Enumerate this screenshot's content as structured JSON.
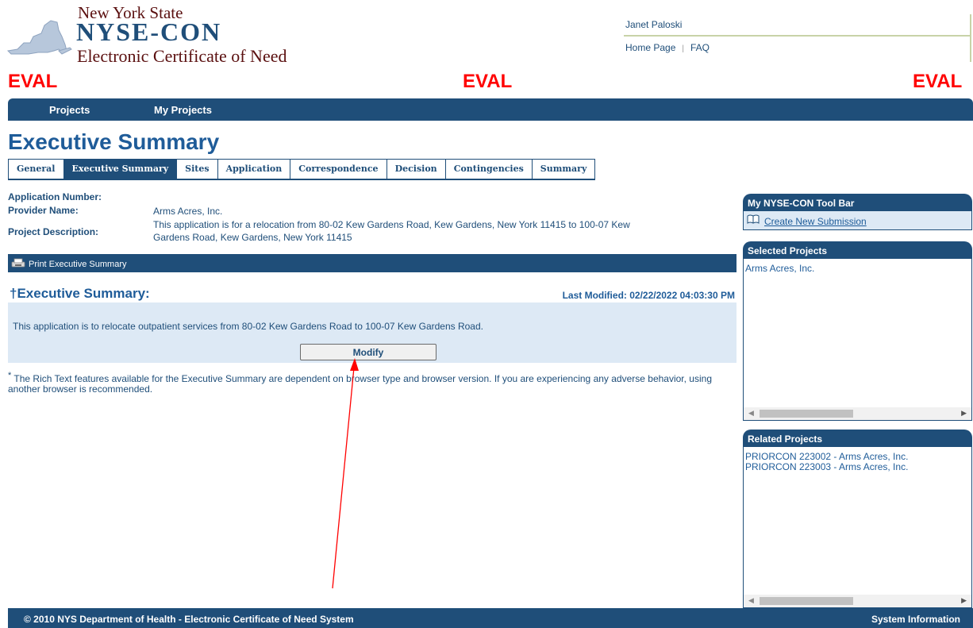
{
  "header": {
    "logo_line1": "New York State",
    "logo_line2": "NYSE-CON",
    "logo_line3": "Electronic Certificate of Need",
    "user_name": "Janet Paloski",
    "links": [
      "Home Page",
      "FAQ"
    ]
  },
  "eval_watermark": "EVAL",
  "nav": {
    "items": [
      "Projects",
      "My Projects"
    ]
  },
  "page_title": "Executive Summary",
  "tabs": [
    {
      "label": "General",
      "active": false
    },
    {
      "label": "Executive Summary",
      "active": true
    },
    {
      "label": "Sites",
      "active": false
    },
    {
      "label": "Application",
      "active": false
    },
    {
      "label": "Correspondence",
      "active": false
    },
    {
      "label": "Decision",
      "active": false
    },
    {
      "label": "Contingencies",
      "active": false
    },
    {
      "label": "Summary",
      "active": false
    }
  ],
  "info": {
    "app_number_label": "Application Number:",
    "app_number_value": "",
    "provider_label": "Provider Name:",
    "provider_value": "Arms Acres, Inc.",
    "description_label": "Project Description:",
    "description_line1": "This application is for a relocation from 80-02 Kew Gardens Road, Kew Gardens, New York 11415 to 100-07 Kew",
    "description_line2": "Gardens Road, Kew Gardens, New York 11415"
  },
  "print_bar": {
    "label": "Print Executive Summary"
  },
  "summary": {
    "heading": "†Executive Summary:",
    "last_modified": "Last Modified: 02/22/2022 04:03:30 PM",
    "text": "This application is to relocate outpatient services from 80-02 Kew Gardens Road to 100-07 Kew Gardens Road.",
    "modify_label": "Modify",
    "note_mark": "*",
    "note": " The Rich Text features available for the Executive Summary are dependent on browser type and browser version. If you are experiencing any adverse behavior, using another browser is recommended."
  },
  "sidebar": {
    "toolbar_title": "My NYSE-CON Tool Bar",
    "create_label": "Create New Submission",
    "selected_title": "Selected Projects",
    "selected_items": [
      "Arms Acres, Inc."
    ],
    "related_title": "Related Projects",
    "related_items": [
      "PRIORCON 223002 - Arms Acres, Inc.",
      "PRIORCON 223003 - Arms Acres, Inc."
    ]
  },
  "footer": {
    "copyright": "© 2010 NYS Department of Health - Electronic Certificate of Need System",
    "system_info": "System Information"
  },
  "colors": {
    "primary": "#1f4e79",
    "eval": "#ff0000",
    "annotation_arrow": "#ff0000",
    "summary_bg": "#dde9f5"
  }
}
